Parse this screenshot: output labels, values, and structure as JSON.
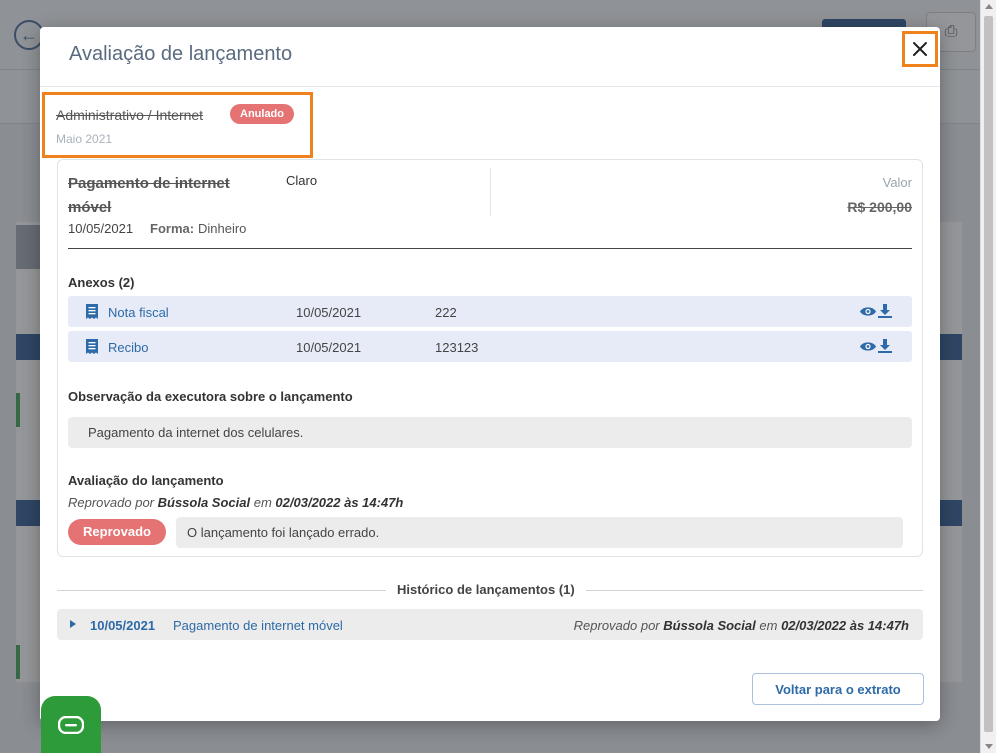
{
  "modal": {
    "title": "Avaliação de lançamento",
    "category": "Administrativo / Internet",
    "status": "Anulado",
    "month": "Maio 2021"
  },
  "entry": {
    "title": "Pagamento de internet móvel",
    "vendor": "Claro",
    "value_label": "Valor",
    "value": "R$ 200,00",
    "date": "10/05/2021",
    "form_label": "Forma:",
    "form_value": "Dinheiro"
  },
  "attachments": {
    "title": "Anexos (2)",
    "items": [
      {
        "name": "Nota fiscal",
        "date": "10/05/2021",
        "number": "222"
      },
      {
        "name": "Recibo",
        "date": "10/05/2021",
        "number": "123123"
      }
    ]
  },
  "observation": {
    "title": "Observação da executora sobre o lançamento",
    "text": "Pagamento da internet dos celulares."
  },
  "evaluation": {
    "title": "Avaliação do lançamento",
    "prefix": "Reprovado por",
    "user": "Bússola Social",
    "connector": "em",
    "datetime": "02/03/2022 às 14:47h",
    "status": "Reprovado",
    "comment": "O lançamento foi lançado errado."
  },
  "history": {
    "title": "Histórico de lançamentos (1)",
    "items": [
      {
        "date": "10/05/2021",
        "description": "Pagamento de internet móvel",
        "prefix": "Reprovado por",
        "user": "Bússola Social",
        "connector": "em",
        "datetime": "02/03/2022 às 14:47h"
      }
    ]
  },
  "footer": {
    "back_label": "Voltar para o extrato"
  },
  "colors": {
    "accent": "#2e6aa8",
    "danger": "#e57373",
    "highlight": "#f0821e",
    "chat": "#2e9b3a"
  }
}
